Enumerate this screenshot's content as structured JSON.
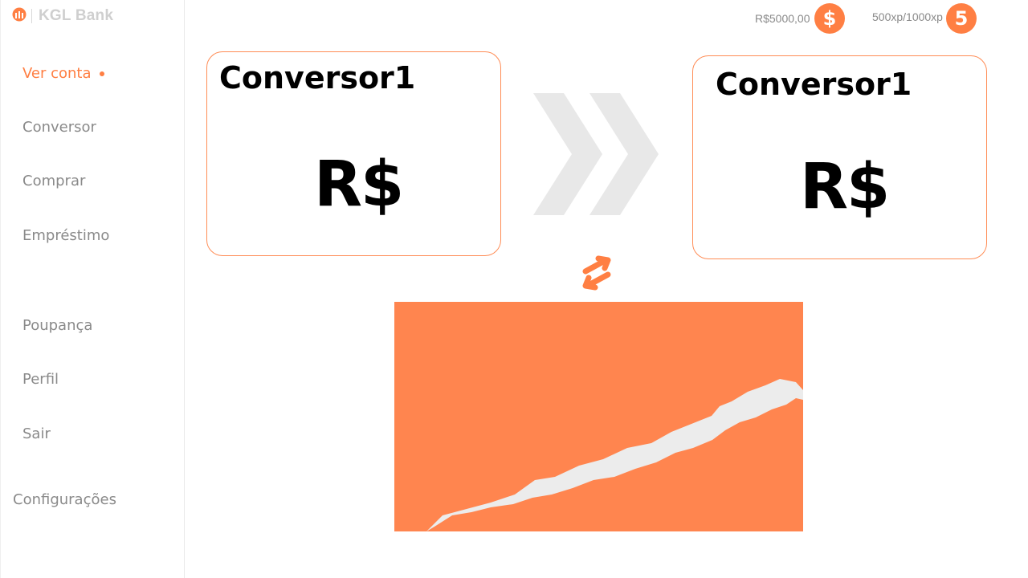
{
  "brand": {
    "name": "KGL Bank",
    "logo_icon": "bank-logo-icon"
  },
  "sidebar": {
    "items": [
      {
        "label": "Ver conta",
        "active": true
      },
      {
        "label": "Conversor"
      },
      {
        "label": "Comprar"
      },
      {
        "label": "Empréstimo"
      },
      {
        "label": "Poupança"
      },
      {
        "label": "Perfil"
      },
      {
        "label": "Sair"
      },
      {
        "label": "Configurações"
      }
    ]
  },
  "header": {
    "balance": "R$5000,00",
    "balance_icon": "$",
    "xp": "500xp/1000xp",
    "level": "5"
  },
  "converter": {
    "from": {
      "title": "Conversor1",
      "currency": "R$"
    },
    "to": {
      "title": "Conversor1",
      "currency": "R$"
    },
    "arrows_icon": "double-chevron-right-icon",
    "swap_icon": "swap-arrows-icon"
  },
  "colors": {
    "accent": "#ff7f43",
    "muted_text": "#8a8a8a",
    "card_border": "#ff8c55",
    "arrow_gray": "#e8e8e8",
    "panel": "#ff854f"
  }
}
